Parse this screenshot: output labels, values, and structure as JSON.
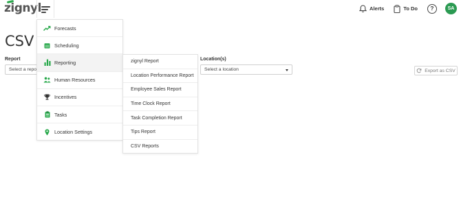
{
  "app": {
    "logo_text": "zignyl"
  },
  "header": {
    "alerts_label": "Alerts",
    "todo_label": "To Do",
    "help_label": "?",
    "avatar_initials": "SA"
  },
  "page": {
    "title": "CSV Re",
    "report_label": "Report",
    "report_placeholder": "Select a report",
    "location_label": "Location(s)",
    "location_placeholder": "Select a location",
    "export_label": "Export as CSV"
  },
  "menu": {
    "items": [
      {
        "label": "Forecasts",
        "icon": "trend-up-icon"
      },
      {
        "label": "Scheduling",
        "icon": "calendar-icon"
      },
      {
        "label": "Reporting",
        "icon": "bar-chart-icon",
        "active": true
      },
      {
        "label": "Human Resources",
        "icon": "people-icon"
      },
      {
        "label": "Incentives",
        "icon": "trophy-icon"
      },
      {
        "label": "Tasks",
        "icon": "clipboard-icon"
      },
      {
        "label": "Location Settings",
        "icon": "map-pin-icon"
      }
    ]
  },
  "submenu": {
    "items": [
      {
        "label": "zignyl Report"
      },
      {
        "label": "Location Performance Report"
      },
      {
        "label": "Employee Sales Report"
      },
      {
        "label": "Time Clock Report"
      },
      {
        "label": "Task Completion Report"
      },
      {
        "label": "Tips Report"
      },
      {
        "label": "CSV Reports"
      }
    ]
  },
  "colors": {
    "accent_green": "#2b9a52",
    "icon_green": "#27a84a"
  }
}
